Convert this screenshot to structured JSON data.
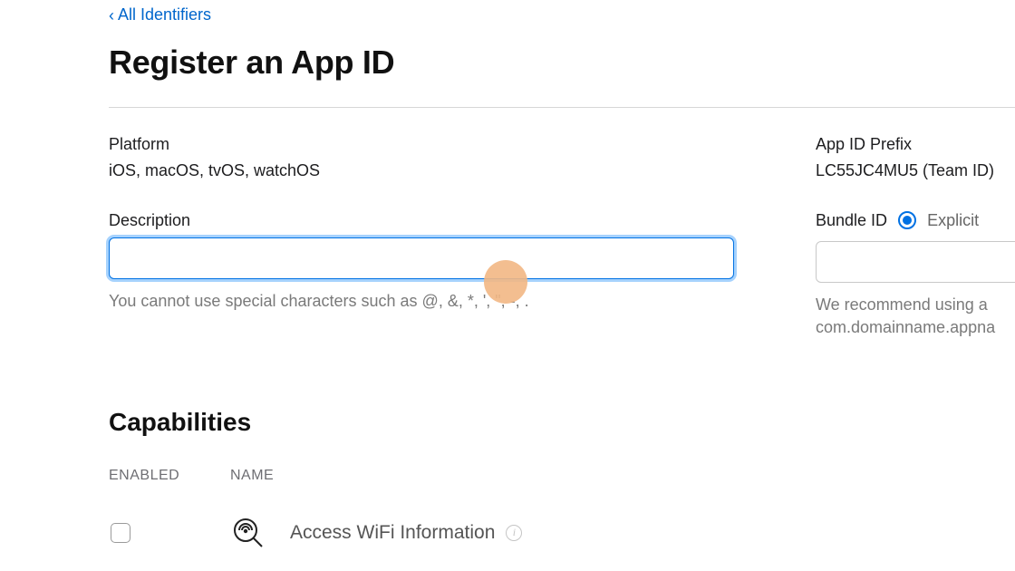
{
  "nav": {
    "back_label": "All Identifiers"
  },
  "header": {
    "title": "Register an App ID"
  },
  "platform": {
    "label": "Platform",
    "value": "iOS, macOS, tvOS, watchOS"
  },
  "prefix": {
    "label": "App ID Prefix",
    "value": "LC55JC4MU5 (Team ID)"
  },
  "description": {
    "label": "Description",
    "value": "",
    "hint": "You cannot use special characters such as @, &, *, ', \", -, ."
  },
  "bundle": {
    "label": "Bundle ID",
    "radio_explicit": "Explicit",
    "value": "",
    "hint1": "We recommend using a",
    "hint2": "com.domainname.appna"
  },
  "capabilities": {
    "title": "Capabilities",
    "col_enabled": "ENABLED",
    "col_name": "NAME",
    "items": [
      {
        "name": "Access WiFi Information",
        "enabled": false
      }
    ]
  }
}
